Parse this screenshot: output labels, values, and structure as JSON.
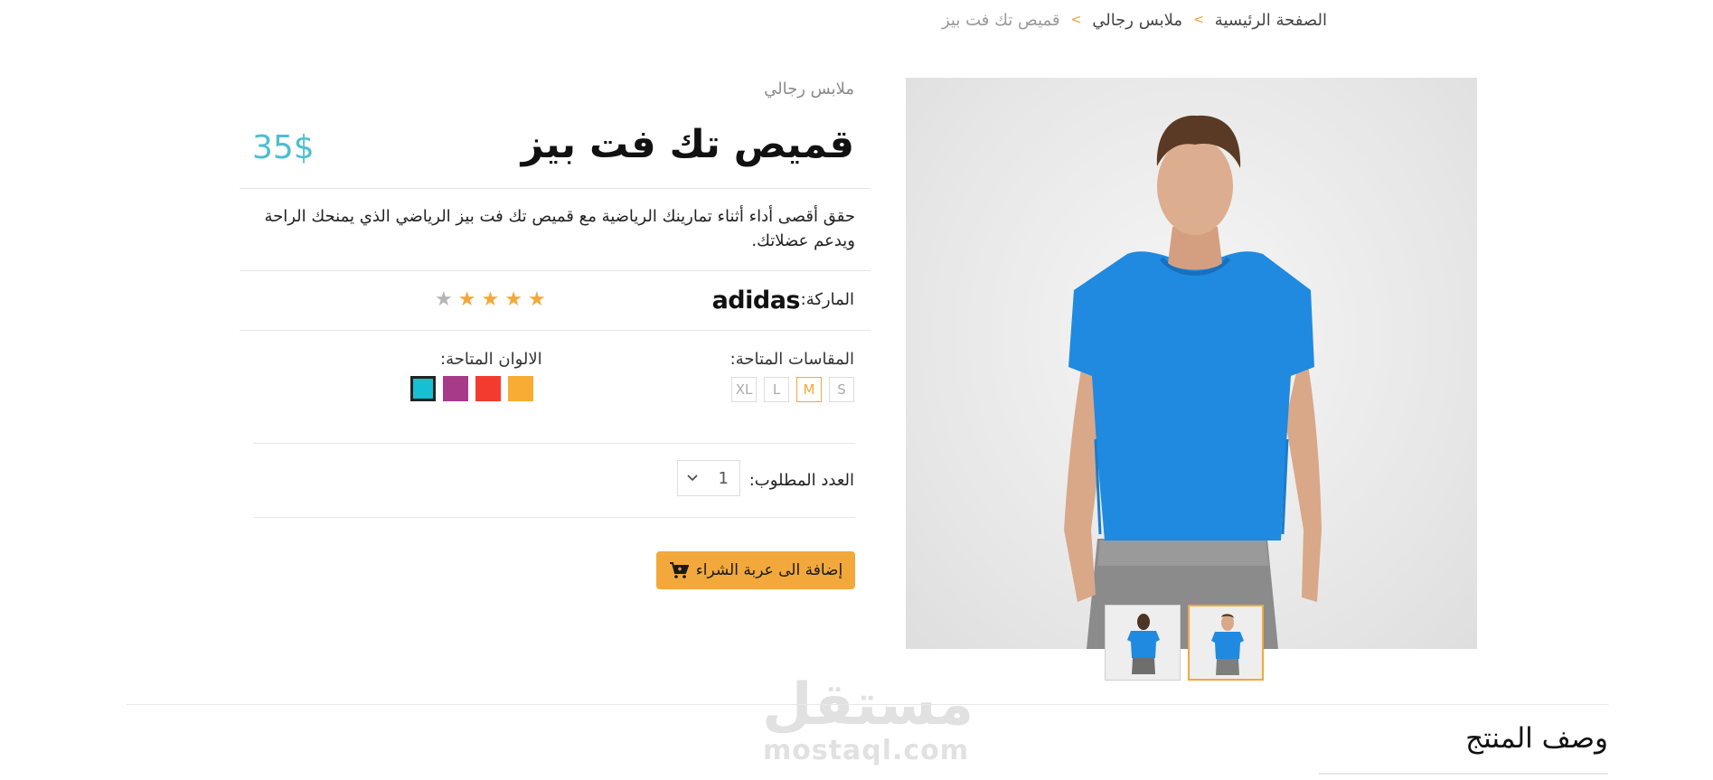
{
  "breadcrumb": {
    "home": "الصفحة الرئيسية",
    "category": "ملابس رجالي",
    "current": "قميص تك فت بيز",
    "separator": ">"
  },
  "product": {
    "category": "ملابس رجالي",
    "title": "قميص تك فت بيز",
    "price": "35$",
    "description": "حقق أقصى أداء أثناء تمارينك الرياضية مع قميص تك فت بيز الرياضي الذي يمنحك الراحة ويدعم عضلاتك.",
    "brand_label": "الماركة:",
    "brand_name": "adidas",
    "rating": 4,
    "rating_max": 5,
    "sizes_label": "المقاسات المتاحة:",
    "sizes": [
      "S",
      "M",
      "L",
      "XL"
    ],
    "selected_size": "M",
    "colors_label": "الالوان المتاحة:",
    "colors": [
      "#f8ac33",
      "#f43b2f",
      "#a83a8a",
      "#17bfd3"
    ],
    "selected_color": "#17bfd3",
    "quantity_label": "العدد المطلوب:",
    "quantity": "1",
    "add_to_cart_label": "إضافة الى عربة الشراء"
  },
  "section": {
    "description_title": "وصف المنتج"
  },
  "watermark": {
    "arabic": "مستقل",
    "latin": "mostaql.com"
  },
  "colors": {
    "accent": "#f3a83b",
    "price": "#4dbed0",
    "star_filled": "#f3a83b",
    "star_empty": "#b5b5b5",
    "shirt": "#1f8ae0"
  },
  "icons": {
    "cart": "shopping-cart-icon",
    "chevron": "chevron-down-icon",
    "star": "star-icon"
  }
}
